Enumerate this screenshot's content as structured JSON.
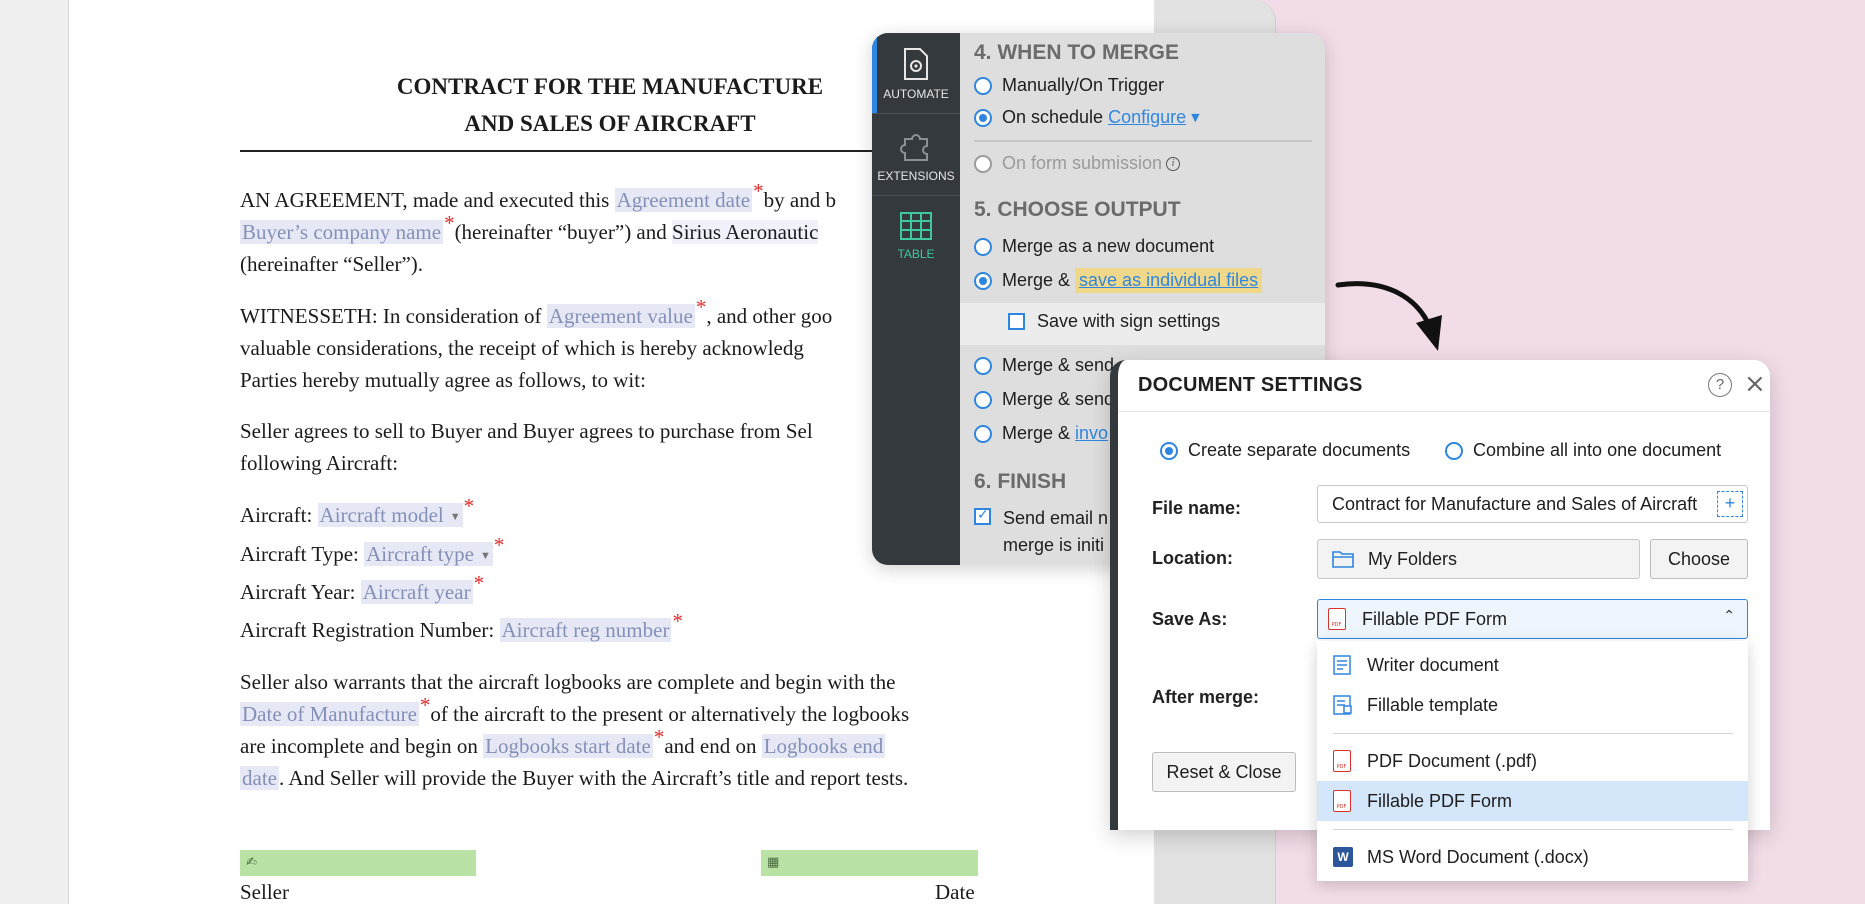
{
  "document": {
    "title_line1": "CONTRACT FOR THE MANUFACTURE",
    "title_line2": "AND SALES OF AIRCRAFT",
    "p1_t1": "AN AGREEMENT, made and executed this ",
    "p1_f1": "Agreement date",
    "p1_t2": "by and b",
    "p1_f2": "Buyer’s company name",
    "p1_t3": "(hereinafter “buyer”) and ",
    "p1_t4": "Sirius Aeronautic",
    "p1_t5": "(hereinafter “Seller”).",
    "p2_t1": "WITNESSETH: In consideration of ",
    "p2_f1": "Agreement value",
    "p2_t2": ", and other goo",
    "p2_t3": "valuable considerations, the receipt of which is hereby acknowledg",
    "p2_t4": "Parties hereby mutually agree as follows, to wit:",
    "p3_t1": "Seller agrees to sell to Buyer and Buyer agrees to purchase from Sel",
    "p3_t2": "following Aircraft:",
    "aircraft_label": "Aircraft: ",
    "aircraft_field": "Aircraft model",
    "type_label": "Aircraft Type: ",
    "type_field": "Aircraft type",
    "year_label": "Aircraft Year: ",
    "year_field": "Aircraft year",
    "reg_label": "Aircraft Registration Number: ",
    "reg_field": "Aircraft reg number",
    "p4_t1": "Seller also warrants that the aircraft logbooks are complete and begin with the",
    "p4_f1": "Date of Manufacture",
    "p4_t2": "of the aircraft to the present or alternatively the logbooks",
    "p4_t3": "are incomplete and begin on ",
    "p4_f2": "Logbooks start date",
    "p4_t4": "and end on ",
    "p4_f3a": "Logbooks end",
    "p4_f3b": "date",
    "p4_t5": ". And Seller will provide the Buyer with the Aircraft’s title and report tests.",
    "required_mark": "*",
    "seller_label": "Seller",
    "date_label": "Date"
  },
  "sidebar": {
    "items": [
      {
        "label": "AUTOMATE",
        "icon": "automate-gear-doc-icon",
        "active": true
      },
      {
        "label": "EXTENSIONS",
        "icon": "puzzle-icon"
      },
      {
        "label": "TABLE",
        "icon": "table-icon"
      }
    ]
  },
  "automate": {
    "sec4": "4. WHEN TO MERGE",
    "manual": "Manually/On Trigger",
    "schedule": "On schedule ",
    "configure": "Configure",
    "form_submission": "On form submission",
    "sec5": "5. CHOOSE OUTPUT",
    "merge_new": "Merge as a new document",
    "merge_save_prefix": "Merge & ",
    "merge_save_link": "save as individual files",
    "save_sign": "Save with sign settings",
    "merge_send1": "Merge & send",
    "merge_send1_link": "...",
    "merge_send2": "Merge & send",
    "merge_inv_prefix": "Merge & ",
    "merge_inv_link": "invo",
    "sec6": "6. FINISH",
    "send_email": "Send email n",
    "merge_init": "merge is initi"
  },
  "dialog": {
    "title": "DOCUMENT SETTINGS",
    "opt_separate": "Create separate documents",
    "opt_combine": "Combine all into one document",
    "file_name_label": "File name:",
    "file_name_value": "Contract for Manufacture and Sales of Aircraft",
    "location_label": "Location:",
    "location_value": "My Folders",
    "choose_button": "Choose",
    "save_as_label": "Save As:",
    "save_as_value": "Fillable PDF Form",
    "after_merge_label": "After merge:",
    "reset_button": "Reset & Close",
    "menu": [
      {
        "label": "Writer document",
        "icon": "writer-doc-icon"
      },
      {
        "label": "Fillable template",
        "icon": "fillable-template-icon"
      },
      {
        "label": "PDF Document (.pdf)",
        "icon": "pdf-icon"
      },
      {
        "label": "Fillable PDF Form",
        "icon": "pdf-icon",
        "selected": true
      },
      {
        "label": "MS Word Document (.docx)",
        "icon": "word-icon"
      }
    ]
  },
  "colors": {
    "accent": "#2f86e0",
    "required": "#e02a2a",
    "highlight": "#f0d88a",
    "signature_field": "#b9e3a4",
    "rail": "#34393d",
    "pink_bg": "#f2dce8"
  }
}
